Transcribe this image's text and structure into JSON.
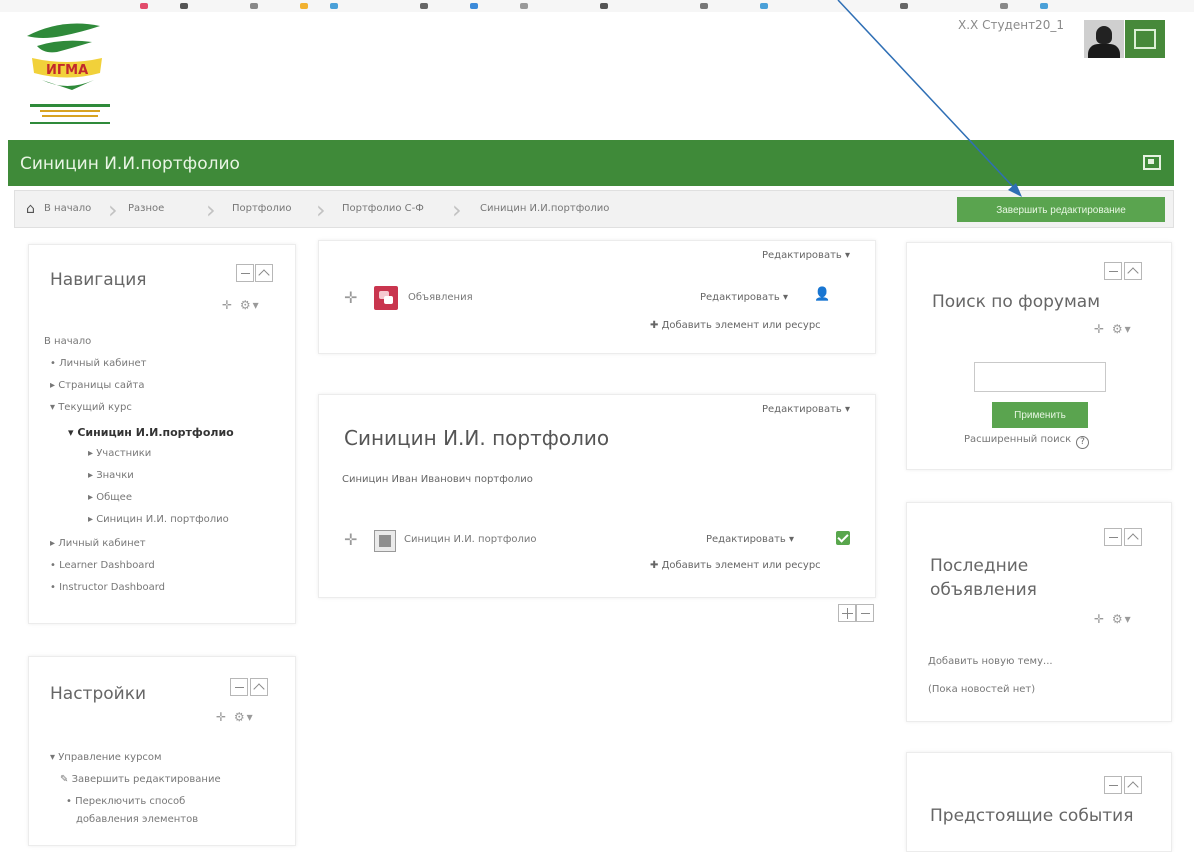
{
  "header": {
    "user_name": "Х.Х Студент20_1"
  },
  "course": {
    "title": "Синицин И.И.портфолио"
  },
  "breadcrumb": {
    "items": [
      "В начало",
      "Разное",
      "Портфолио",
      "Портфолио С-Ф",
      "Синицин И.И.портфолио"
    ],
    "finish_button": "Завершить редактирование"
  },
  "navigation": {
    "title": "Навигация",
    "items": [
      "В начало",
      "Личный кабинет",
      "Страницы сайта",
      "Текущий курс",
      "Синицин И.И.портфолио",
      "Участники",
      "Значки",
      "Общее",
      "Синицин И.И. портфолио",
      "Личный кабинет",
      "Learner Dashboard",
      "Instructor Dashboard"
    ]
  },
  "settings": {
    "title": "Настройки",
    "items": [
      "Управление курсом",
      "Завершить редактирование",
      "Переключить способ",
      "добавления элементов"
    ]
  },
  "section0": {
    "edit": "Редактировать",
    "activity_name": "Объявления",
    "activity_edit": "Редактировать",
    "add": "Добавить элемент или ресурс"
  },
  "section1": {
    "edit": "Редактировать",
    "title": "Синицин И.И. портфолио",
    "summary": "Синицин Иван Иванович портфолио",
    "activity_name": "Синицин И.И. портфолио",
    "activity_edit": "Редактировать",
    "add": "Добавить элемент или ресурс"
  },
  "forum_search": {
    "title": "Поиск по форумам",
    "search_value": "",
    "apply": "Применить",
    "advanced": "Расширенный поиск"
  },
  "news": {
    "title_line1": "Последние",
    "title_line2": "объявления",
    "add_topic": "Добавить новую тему...",
    "empty": "(Пока новостей нет)"
  },
  "events": {
    "title": "Предстоящие события"
  },
  "colors": {
    "brand_green": "#3f8a39",
    "button_green": "#5aa44f",
    "forum_icon": "#c9354e",
    "annotation_arrow": "#2f6fb5"
  },
  "icons": [
    "home-icon",
    "chevron-right-icon",
    "move-icon",
    "gear-icon",
    "user-icon",
    "checkbox-icon",
    "help-icon",
    "fullscreen-icon",
    "notification-icon"
  ]
}
